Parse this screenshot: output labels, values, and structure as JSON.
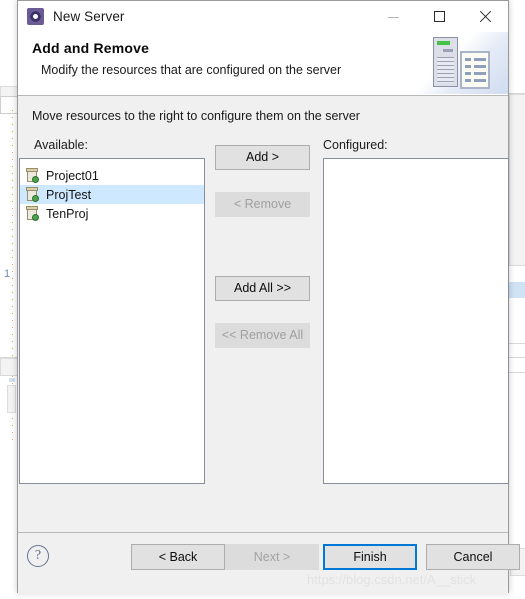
{
  "window": {
    "title": "New Server",
    "icon": "server-gear-icon",
    "controls": {
      "minimize": "minimize-icon",
      "maximize": "maximize-icon",
      "close": "close-icon"
    }
  },
  "wizard_header": {
    "title": "Add and Remove",
    "description": "Modify the resources that are configured on the server",
    "banner_icon": "server-tower-and-document-icon"
  },
  "body": {
    "instruction": "Move resources to the right to configure them on the server",
    "available": {
      "label": "Available:",
      "items": [
        {
          "name": "Project01",
          "icon": "java-project-icon",
          "selected": false
        },
        {
          "name": "ProjTest",
          "icon": "java-project-icon",
          "selected": true
        },
        {
          "name": "TenProj",
          "icon": "java-project-icon",
          "selected": false
        }
      ]
    },
    "configured": {
      "label": "Configured:",
      "items": []
    },
    "transfer_buttons": [
      {
        "label": "Add >",
        "enabled": true
      },
      {
        "label": "< Remove",
        "enabled": false
      },
      {
        "label": "Add All >>",
        "enabled": true
      },
      {
        "label": "<< Remove All",
        "enabled": false
      }
    ]
  },
  "footer": {
    "help": "?",
    "back": "< Back",
    "next": "Next >",
    "finish": "Finish",
    "cancel": "Cancel"
  },
  "watermark": "https://blog.csdn.net/A__stick",
  "colors": {
    "accent": "#0078d7",
    "selection": "#cde8ff",
    "dialog_bg": "#f0f0f0",
    "list_bg": "#ffffff",
    "disabled_text": "#a0a0a0"
  },
  "background_labels": {
    "line_number": "1"
  }
}
